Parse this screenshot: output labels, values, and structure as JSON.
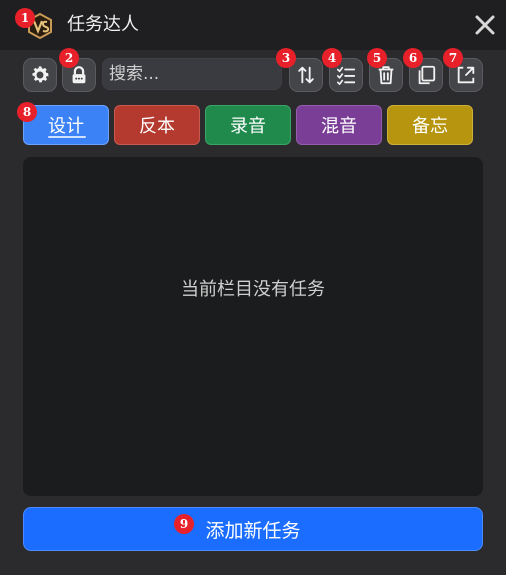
{
  "app": {
    "title": "任务达人"
  },
  "toolbar": {
    "search_placeholder": "搜索...",
    "icons": [
      "gear-icon",
      "lock-icon",
      "sort-icon",
      "checklist-icon",
      "trash-icon",
      "copy-icon",
      "export-icon"
    ]
  },
  "tabs": [
    {
      "label": "设计",
      "color": "#3b82f6",
      "active": true
    },
    {
      "label": "反本",
      "color": "#b4392f",
      "active": false
    },
    {
      "label": "录音",
      "color": "#1f8a4c",
      "active": false
    },
    {
      "label": "混音",
      "color": "#7a3e96",
      "active": false
    },
    {
      "label": "备忘",
      "color": "#b8950f",
      "active": false
    }
  ],
  "content": {
    "empty_text": "当前栏目没有任务"
  },
  "add_button": {
    "label": "添加新任务"
  },
  "badges": [
    "1",
    "2",
    "3",
    "4",
    "5",
    "6",
    "7",
    "8",
    "9"
  ],
  "colors": {
    "accent": "#1a6dff",
    "badge": "#e8202a",
    "background": "#2b2b2d"
  }
}
